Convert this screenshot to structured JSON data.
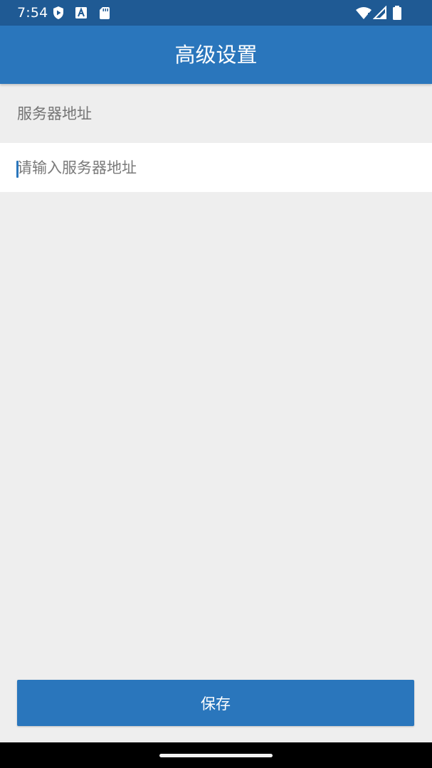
{
  "status_bar": {
    "time": "7:54",
    "left_icons": [
      "play-protect-icon",
      "font-a-icon",
      "sd-card-icon"
    ],
    "right_icons": [
      "wifi-icon",
      "signal-icon",
      "battery-icon"
    ]
  },
  "header": {
    "title": "高级设置",
    "background_color": "#2a76bc"
  },
  "form": {
    "server_label": "服务器地址",
    "server_input_value": "",
    "server_input_placeholder": "请输入服务器地址"
  },
  "actions": {
    "save_label": "保存"
  },
  "colors": {
    "status_bar": "#1f5a94",
    "accent": "#2a76bc",
    "page_background": "#eeeeee"
  }
}
